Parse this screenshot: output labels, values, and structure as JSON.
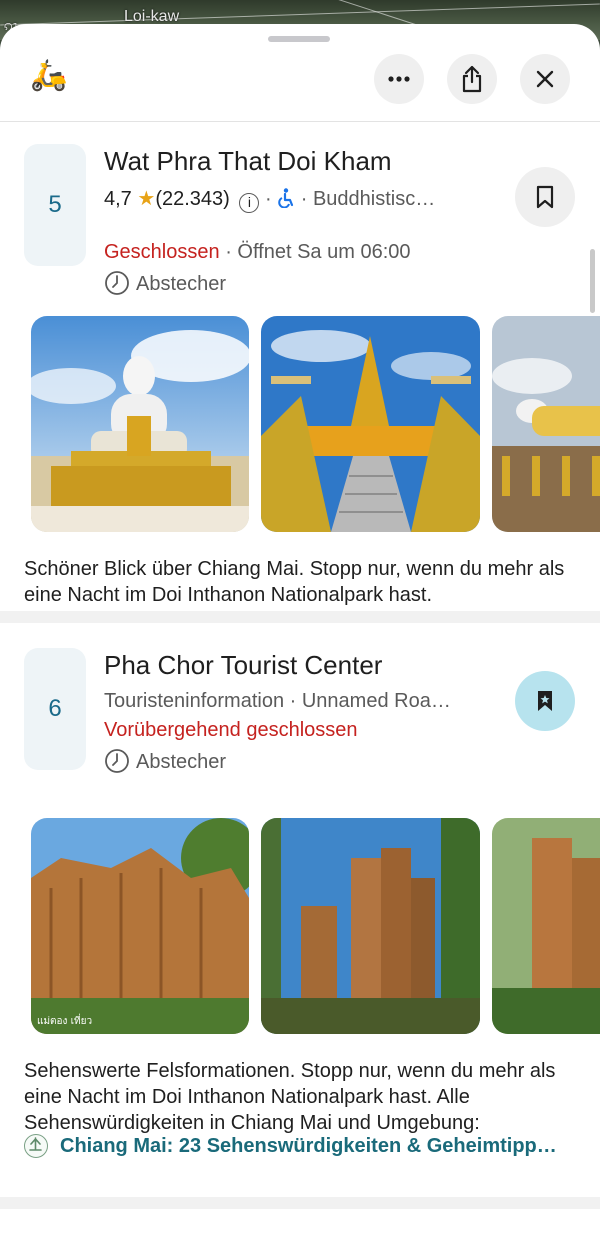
{
  "map": {
    "labels": [
      "Loi-kaw",
      "ၵၢ"
    ]
  },
  "header": {
    "more_icon": "more-horizontal-icon",
    "share_icon": "share-icon",
    "close_icon": "close-icon"
  },
  "places": [
    {
      "number": "5",
      "name": "Wat Phra That Doi Kham",
      "rating": "4,7",
      "reviews": "(22.343)",
      "category": "Buddhistisc…",
      "status": "Geschlossen",
      "opens": "Öffnet Sa um 06:00",
      "tag": "Abstecher",
      "saved": false,
      "description": "Schöner Blick über Chiang Mai. Stopp nur, wenn du mehr als eine Nacht im Doi Inthanon Nationalpark hast."
    },
    {
      "number": "6",
      "name": "Pha Chor Tourist Center",
      "subtitle": "Touristeninformation · Unnamed Roa…",
      "status": "Vorübergehend geschlossen",
      "tag": "Abstecher",
      "saved": true,
      "description": "Sehenswerte Felsformationen. Stopp nur, wenn du mehr als eine Nacht im Doi Inthanon Nationalpark hast. Alle Sehenswürdigkeiten in Chiang Mai und Umgebung:",
      "photo_watermark": "แม่ตอง เที่ยว",
      "link": "Chiang Mai: 23 Sehenswürdigkeiten & Geheimtipp…"
    }
  ],
  "colors": {
    "accent": "#1a6a8a",
    "closed": "#c5221f",
    "saved_bg": "#b7e3ee",
    "star": "#e8a317"
  }
}
